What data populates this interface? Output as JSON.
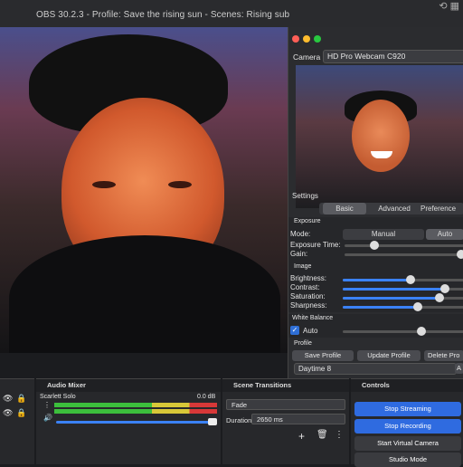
{
  "window": {
    "title": "OBS 30.2.3 - Profile: Save the rising sun - Scenes: Rising sub"
  },
  "camera_dialog": {
    "camera_label": "Camera",
    "camera_value": "HD Pro Webcam C920",
    "settings_label": "Settings",
    "tabs": [
      "Basic",
      "Advanced",
      "Preference"
    ],
    "exposure_heading": "Exposure",
    "mode_label": "Mode:",
    "mode_options": [
      "Manual",
      "Auto"
    ],
    "exposure_time_label": "Exposure Time:",
    "gain_label": "Gain:",
    "image_heading": "Image",
    "brightness_label": "Brightness:",
    "contrast_label": "Contrast:",
    "saturation_label": "Saturation:",
    "sharpness_label": "Sharpness:",
    "brightness": 0.56,
    "contrast": 0.84,
    "saturation": 0.8,
    "sharpness": 0.62,
    "white_balance_heading": "White Balance",
    "auto_label": "Auto",
    "profile_heading": "Profile",
    "save_profile": "Save Profile",
    "update_profile": "Update Profile",
    "delete_profile": "Delete Pro",
    "profile_value": "Daytime 8",
    "profile_extra": "A"
  },
  "audio_mixer": {
    "title": "Audio Mixer",
    "source": "Scarlett Solo",
    "db": "0.0 dB",
    "level": 0.95
  },
  "scene_transitions": {
    "title": "Scene Transitions",
    "transition": "Fade",
    "duration_label": "Duration",
    "duration_value": "2650 ms"
  },
  "controls": {
    "title": "Controls",
    "stop_streaming": "Stop Streaming",
    "stop_recording": "Stop Recording",
    "start_virtual_camera": "Start Virtual Camera",
    "studio_mode": "Studio Mode"
  },
  "colors": {
    "accent": "#2f6fd6",
    "button_active": "#2f6be0"
  }
}
